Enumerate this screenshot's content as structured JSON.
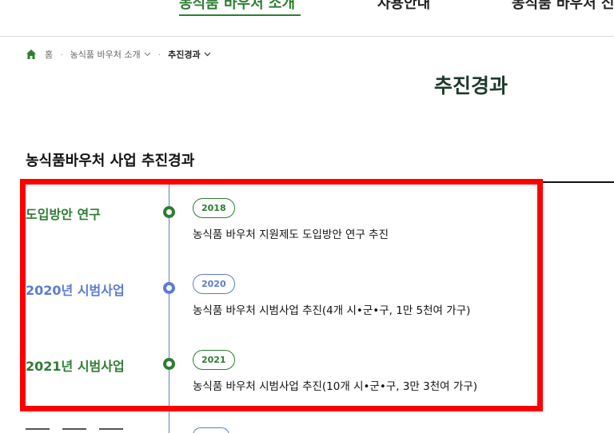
{
  "nav": {
    "items": [
      {
        "label": "농식품 바우처 소개",
        "active": true
      },
      {
        "label": "사용안내",
        "active": false
      },
      {
        "label": "농식품 바우처 신",
        "active": false
      }
    ]
  },
  "breadcrumb": {
    "home": "홈",
    "level1": "농식품 바우처 소개",
    "level2": "추진경과"
  },
  "page": {
    "title": "추진경과",
    "section_title": "농식품바우처 사업 추진경과"
  },
  "timeline": [
    {
      "heading": "도입방안 연구",
      "year": "2018",
      "desc": "농식품 바우처 지원제도 도입방안 연구 추진",
      "color": "#2e7d32"
    },
    {
      "heading": "2020년 시범사업",
      "year": "2020",
      "desc": "농식품 바우처 시범사업 추진(4개 시•군•구, 1만 5천여 가구)",
      "color": "#5b7bd5"
    },
    {
      "heading": "2021년 시범사업",
      "year": "2021",
      "desc": "농식품 바우처 시범사업 추진(10개 시•군•구, 3만 3천여 가구)",
      "color": "#2e7d32"
    }
  ],
  "colors": {
    "green": "#2e7d32",
    "blue": "#5b7bd5",
    "highlight": "#ff0000"
  },
  "icons": {
    "home": "home-icon",
    "chevron": "chevron-down-icon"
  }
}
